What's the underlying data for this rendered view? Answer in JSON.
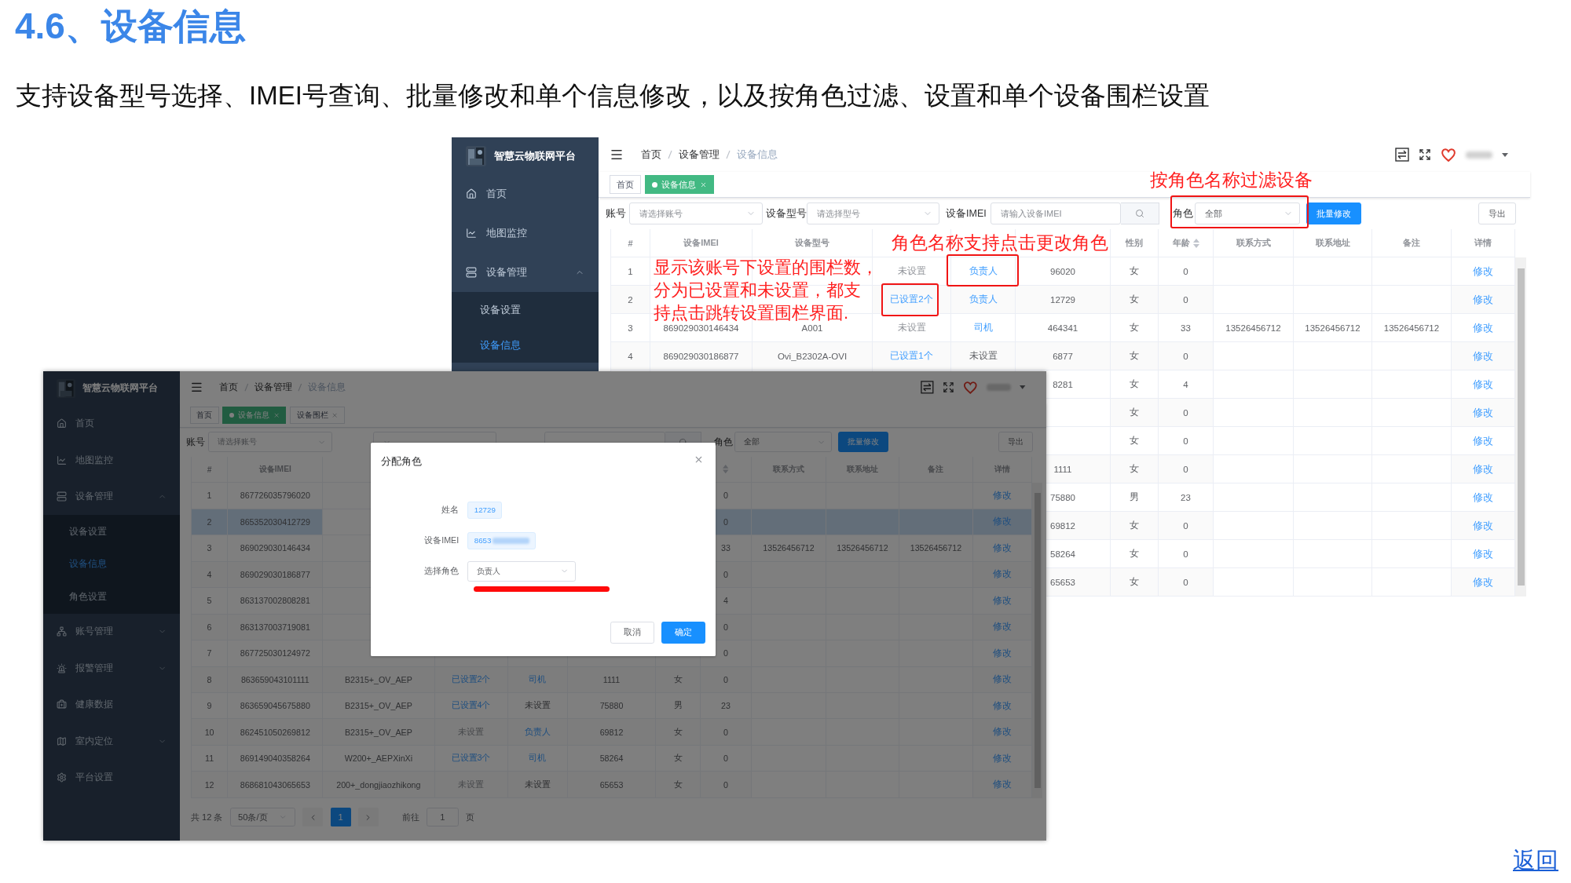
{
  "title": "4.6、设备信息",
  "subtitle": "支持设备型号选择、IMEI号查询、批量修改和单个信息修改，以及按角色过滤、设置和单个设备围栏设置",
  "screens": [
    {
      "app_name": "智慧云物联网平台",
      "menu": [
        {
          "label": "首页"
        },
        {
          "label": "地图监控"
        },
        {
          "label": "设备管理",
          "expanded": true,
          "children": [
            {
              "label": "设备设置",
              "selected": false
            },
            {
              "label": "设备信息",
              "selected": true
            }
          ]
        }
      ],
      "breadcrumb": [
        "首页",
        "设备管理",
        "设备信息"
      ],
      "tags": [
        {
          "label": "首页",
          "selected": false,
          "closable": false
        },
        {
          "label": "设备信息",
          "selected": true,
          "closable": true
        }
      ],
      "filters": {
        "account_label": "账号",
        "account_placeholder": "请选择账号",
        "model_label": "设备型号",
        "model_placeholder": "请选择型号",
        "imei_label": "设备IMEI",
        "imei_placeholder": "请输入设备IMEI",
        "role_label": "角色",
        "role_value": "全部",
        "batch_button": "批量修改",
        "export_button": "导出"
      },
      "columns": [
        {
          "label": "#",
          "sortable": false
        },
        {
          "label": "设备IMEI",
          "sortable": false
        },
        {
          "label": "设备型号",
          "sortable": false
        },
        {
          "sortable": false
        },
        {
          "sortable": false
        },
        {
          "sortable": false
        },
        {
          "label": "性别",
          "sortable": false
        },
        {
          "label": "年龄",
          "sortable": true
        },
        {
          "label": "联系方式",
          "sortable": false
        },
        {
          "label": "联系地址",
          "sortable": false
        },
        {
          "label": "备注",
          "sortable": false
        },
        {
          "label": "详情",
          "sortable": false
        }
      ],
      "rows": [
        {
          "selected": false,
          "no": "1",
          "fence": "未设置",
          "fence_set": false,
          "role": "负责人",
          "role_set": true,
          "name": "96020",
          "gender": "女",
          "age": "0",
          "action": "修改"
        },
        {
          "selected": false,
          "no": "2",
          "fence": "已设置2个",
          "fence_set": true,
          "role": "负责人",
          "role_set": true,
          "name": "12729",
          "gender": "女",
          "age": "0",
          "action": "修改"
        },
        {
          "selected": false,
          "no": "3",
          "imei": "869029030146434",
          "model": "A001",
          "fence": "未设置",
          "fence_set": false,
          "role": "司机",
          "role_set": true,
          "name": "464341",
          "gender": "女",
          "age": "33",
          "phone": "13526456712",
          "address": "13526456712",
          "note": "13526456712",
          "action": "修改"
        },
        {
          "selected": false,
          "no": "4",
          "imei": "869029030186877",
          "model": "Ovi_B2302A-OVI",
          "fence": "已设置1个",
          "fence_set": true,
          "role": "未设置",
          "role_set": false,
          "name": "6877",
          "gender": "女",
          "age": "0",
          "action": "修改"
        },
        {
          "selected": false,
          "name": "8281",
          "gender": "女",
          "age": "4",
          "action": "修改"
        },
        {
          "selected": false,
          "gender": "女",
          "age": "0",
          "action": "修改"
        },
        {
          "selected": false,
          "gender": "女",
          "age": "0",
          "action": "修改"
        },
        {
          "selected": false,
          "name": "1111",
          "gender": "女",
          "age": "0",
          "action": "修改"
        },
        {
          "selected": false,
          "name": "75880",
          "gender": "男",
          "age": "23",
          "action": "修改"
        },
        {
          "selected": false,
          "name": "69812",
          "gender": "女",
          "age": "0",
          "action": "修改"
        },
        {
          "selected": false,
          "name": "58264",
          "gender": "女",
          "age": "0",
          "action": "修改"
        },
        {
          "selected": false,
          "name": "65653",
          "gender": "女",
          "age": "0",
          "action": "修改"
        }
      ]
    },
    {
      "app_name": "智慧云物联网平台",
      "menu": [
        {
          "label": "首页"
        },
        {
          "label": "地图监控"
        },
        {
          "label": "设备管理",
          "expanded": true,
          "children": [
            {
              "label": "设备设置",
              "selected": false
            },
            {
              "label": "设备信息",
              "selected": true
            },
            {
              "label": "角色设置",
              "selected": false
            }
          ]
        },
        {
          "label": "账号管理",
          "expanded": false
        },
        {
          "label": "报警管理",
          "expanded": false
        },
        {
          "label": "健康数据"
        },
        {
          "label": "室内定位",
          "expanded": false
        },
        {
          "label": "平台设置"
        }
      ],
      "breadcrumb": [
        "首页",
        "设备管理",
        "设备信息"
      ],
      "tags": [
        {
          "label": "首页",
          "selected": false,
          "closable": false
        },
        {
          "label": "设备信息",
          "selected": true,
          "closable": true
        },
        {
          "label": "设备围栏",
          "selected": false,
          "closable": true
        }
      ],
      "filters": {
        "account_label": "账号",
        "account_placeholder": "请选择账号",
        "role_label": "角色",
        "role_value": "全部",
        "batch_button": "批量修改",
        "export_button": "导出"
      },
      "columns": [
        {
          "label": "#",
          "sortable": false
        },
        {
          "label": "设备IMEI",
          "sortable": false
        },
        {},
        {},
        {},
        {},
        {},
        {
          "sortable": true
        },
        {
          "label": "联系方式",
          "sortable": false
        },
        {
          "label": "联系地址",
          "sortable": false
        },
        {
          "label": "备注",
          "sortable": false
        },
        {
          "label": "详情",
          "sortable": false
        }
      ],
      "rows": [
        {
          "selected": false,
          "no": "1",
          "imei": "867726035796020",
          "age": "0",
          "action": "修改"
        },
        {
          "selected": true,
          "no": "2",
          "imei": "865352030412729",
          "age": "0",
          "action": "修改"
        },
        {
          "selected": false,
          "no": "3",
          "imei": "869029030146434",
          "age": "33",
          "phone": "13526456712",
          "address": "13526456712",
          "note": "13526456712",
          "action": "修改"
        },
        {
          "selected": false,
          "no": "4",
          "imei": "869029030186877",
          "age": "0",
          "action": "修改"
        },
        {
          "selected": false,
          "no": "5",
          "imei": "863137002808281",
          "age": "4",
          "action": "修改"
        },
        {
          "selected": false,
          "no": "6",
          "imei": "863137003719081",
          "age": "0",
          "action": "修改"
        },
        {
          "selected": false,
          "no": "7",
          "imei": "867725030124972",
          "age": "0",
          "action": "修改"
        },
        {
          "selected": false,
          "no": "8",
          "imei": "863659043101111",
          "model": "B2315+_OV_AEP",
          "fence": "已设置2个",
          "fence_set": true,
          "role": "司机",
          "role_set": true,
          "name": "1111",
          "gender": "女",
          "age": "0",
          "action": "修改"
        },
        {
          "selected": false,
          "no": "9",
          "imei": "863659045675880",
          "model": "B2315+_OV_AEP",
          "fence": "已设置4个",
          "fence_set": true,
          "role": "未设置",
          "role_set": false,
          "name": "75880",
          "gender": "男",
          "age": "23",
          "action": "修改"
        },
        {
          "selected": false,
          "no": "10",
          "imei": "862451050269812",
          "model": "B2315+_OV_AEP",
          "fence": "未设置",
          "fence_set": false,
          "role": "负责人",
          "role_set": true,
          "name": "69812",
          "gender": "女",
          "age": "0",
          "action": "修改"
        },
        {
          "selected": false,
          "no": "11",
          "imei": "869149040358264",
          "model": "W200+_AEPXinXi",
          "fence": "已设置3个",
          "fence_set": true,
          "role": "司机",
          "role_set": true,
          "name": "58264",
          "gender": "女",
          "age": "0",
          "action": "修改"
        },
        {
          "selected": false,
          "no": "12",
          "imei": "868681043065653",
          "model": "200+_dongjiaozhikong",
          "fence": "未设置",
          "fence_set": false,
          "role": "未设置",
          "role_set": false,
          "name": "65653",
          "gender": "女",
          "age": "0",
          "action": "修改"
        }
      ],
      "pagination": {
        "total": "共 12 条",
        "page_size": "50条/页",
        "pages": [
          {
            "label": "1",
            "selected": true
          }
        ],
        "goto_label": "前往",
        "goto_value": "1",
        "page_suffix": "页"
      },
      "dialog": {
        "title": "分配角色",
        "fields": [
          {
            "kind": "tag",
            "label": "姓名",
            "value": "12729",
            "redacted": false
          },
          {
            "kind": "tag",
            "label": "设备IMEI",
            "value": "8653",
            "redacted": true
          },
          {
            "kind": "select",
            "label": "选择角色",
            "value": "负责人"
          }
        ],
        "buttons": [
          {
            "label": "取消",
            "primary": false
          },
          {
            "label": "确定",
            "primary": true
          }
        ]
      }
    }
  ],
  "annotations": [
    {
      "kind": "text",
      "text": "按角色名称过滤设备"
    },
    {
      "kind": "box"
    },
    {
      "kind": "text",
      "text": "角色名称支持点击更改角色"
    },
    {
      "kind": "box"
    },
    {
      "kind": "box"
    },
    {
      "kind": "lines",
      "lines": [
        "显示该账号下设置的围栏数，",
        "分为已设置和未设置，都支",
        "持点击跳转设置围栏界面."
      ]
    },
    {
      "kind": "underline"
    }
  ],
  "back_link": "返回"
}
